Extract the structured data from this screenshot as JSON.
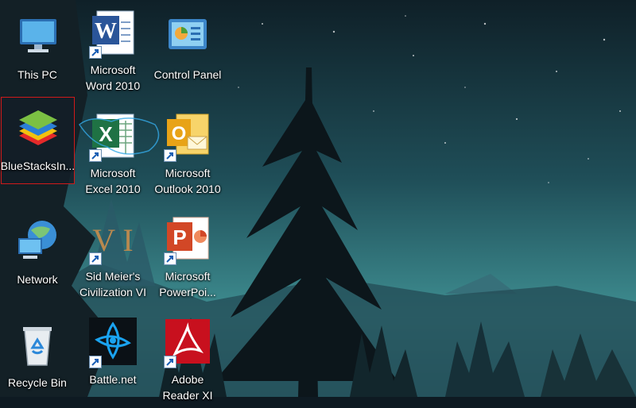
{
  "desktop": {
    "icons": [
      {
        "label": "This PC",
        "icon": "computer-icon"
      },
      {
        "label": "Microsoft\nWord 2010",
        "icon": "word-icon"
      },
      {
        "label": "Control Panel",
        "icon": "control-panel-icon"
      },
      {
        "label": "BlueStacksIn...",
        "icon": "bluestacks-icon",
        "selected": true
      },
      {
        "label": "Microsoft\nExcel 2010",
        "icon": "excel-icon"
      },
      {
        "label": "Microsoft\nOutlook 2010",
        "icon": "outlook-icon"
      },
      {
        "label": "Network",
        "icon": "network-icon"
      },
      {
        "label": "Sid Meier's\nCivilization VI",
        "icon": "civilization-icon"
      },
      {
        "label": "Microsoft\nPowerPoi...",
        "icon": "powerpoint-icon"
      },
      {
        "label": "Recycle Bin",
        "icon": "recycle-bin-icon"
      },
      {
        "label": "Battle.net",
        "icon": "battlenet-icon"
      },
      {
        "label": "Adobe\nReader XI",
        "icon": "adobe-reader-icon"
      }
    ],
    "civ_letters": "V I",
    "word_letter": "W",
    "outlook_letter": "O",
    "powerpoint_letter": "P",
    "excel_letter": "X"
  },
  "colors": {
    "selection_border": "#d11a1a",
    "sky_top": "#0f2028",
    "sky_bottom": "#3a8a8e"
  }
}
